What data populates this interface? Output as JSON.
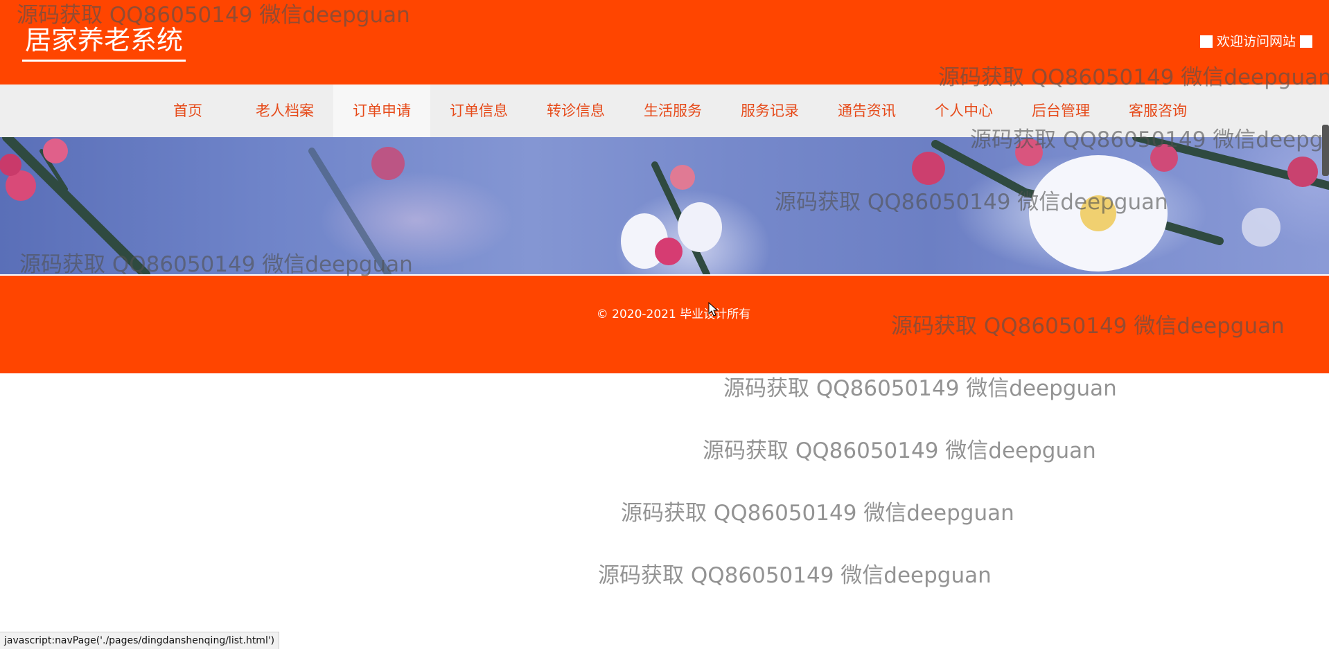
{
  "header": {
    "title": "居家养老系统",
    "welcome": "欢迎访问网站"
  },
  "nav": {
    "items": [
      {
        "label": "首页"
      },
      {
        "label": "老人档案"
      },
      {
        "label": "订单申请",
        "active": true
      },
      {
        "label": "订单信息"
      },
      {
        "label": "转诊信息"
      },
      {
        "label": "生活服务"
      },
      {
        "label": "服务记录"
      },
      {
        "label": "通告资讯"
      },
      {
        "label": "个人中心"
      },
      {
        "label": "后台管理"
      },
      {
        "label": "客服咨询"
      }
    ]
  },
  "footer": {
    "copyright": "© 2020-2021 毕业设计所有"
  },
  "watermark": {
    "text": "源码获取 QQ86050149 微信deepguan"
  },
  "statusbar": {
    "url": "javascript:navPage('./pages/dingdanshenqing/list.html')"
  },
  "colors": {
    "brand": "#ff4500",
    "nav_bg": "#eeeeee",
    "nav_text": "#e64a19"
  }
}
